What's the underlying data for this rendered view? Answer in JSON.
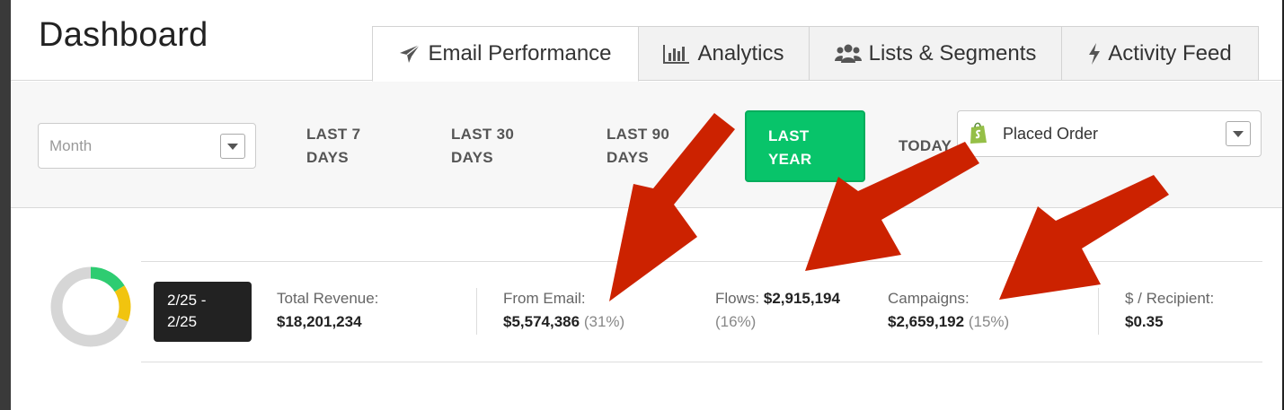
{
  "header": {
    "title": "Dashboard",
    "tabs": [
      {
        "label": "Email Performance",
        "icon": "paper-plane-icon",
        "active": true
      },
      {
        "label": "Analytics",
        "icon": "bar-chart-icon",
        "active": false
      },
      {
        "label": "Lists & Segments",
        "icon": "users-icon",
        "active": false
      },
      {
        "label": "Activity Feed",
        "icon": "bolt-icon",
        "active": false
      }
    ]
  },
  "filters": {
    "month_placeholder": "Month",
    "ranges": [
      {
        "line1": "LAST 7",
        "line2": "DAYS"
      },
      {
        "line1": "LAST 30",
        "line2": "DAYS"
      },
      {
        "line1": "LAST 90",
        "line2": "DAYS"
      },
      {
        "line1": "LAST",
        "line2": "YEAR",
        "selected": true
      },
      {
        "line1": "TODAY",
        "line2": ""
      }
    ],
    "metric_select": {
      "label": "Placed Order",
      "icon": "shopify-icon"
    }
  },
  "stats": {
    "date_range_line1": "2/25 -",
    "date_range_line2": "2/25",
    "total_label": "Total Revenue:",
    "total_value": "$18,201,234",
    "email_label": "From Email:",
    "email_value": "$5,574,386",
    "email_pct": "(31%)",
    "flows_label": "Flows:",
    "flows_value": "$2,915,194",
    "flows_pct": "(16%)",
    "campaigns_label": "Campaigns:",
    "campaigns_value": "$2,659,192",
    "campaigns_pct": "(15%)",
    "recipient_label": "$ / Recipient:",
    "recipient_value": "$0.35",
    "donut_segments": [
      {
        "name": "Flows",
        "percent": 16,
        "color": "#2ecc71"
      },
      {
        "name": "Campaigns",
        "percent": 15,
        "color": "#f1c40f"
      },
      {
        "name": "Other",
        "percent": 69,
        "color": "#d6d6d6"
      }
    ]
  },
  "colors": {
    "accent_green": "#08c46a",
    "annotation_red": "#cc2200"
  }
}
